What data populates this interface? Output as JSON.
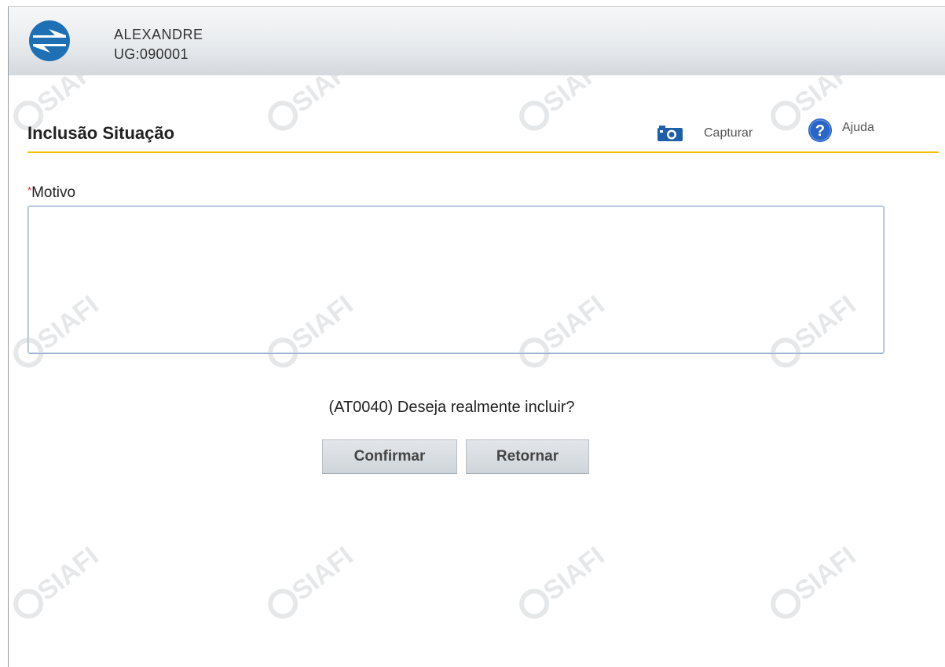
{
  "header": {
    "user_name": "ALEXANDRE",
    "ug": "UG:090001"
  },
  "page": {
    "title": "Inclusão Situação"
  },
  "toolbar": {
    "capture_label": "Capturar",
    "help_label": "Ajuda"
  },
  "form": {
    "motivo_label": "Motivo",
    "required_marker": "*",
    "motivo_value": ""
  },
  "confirmation": {
    "message": "(AT0040) Deseja realmente incluir?",
    "confirm_label": "Confirmar",
    "return_label": "Retornar"
  },
  "watermark": {
    "text": "SIAFI"
  },
  "colors": {
    "accent_rule": "#f2c200",
    "logo_blue": "#1f6fb5",
    "help_blue": "#2a66c8",
    "required_red": "#e02020"
  },
  "icons": [
    "siafi-logo-icon",
    "camera-icon",
    "help-icon"
  ]
}
